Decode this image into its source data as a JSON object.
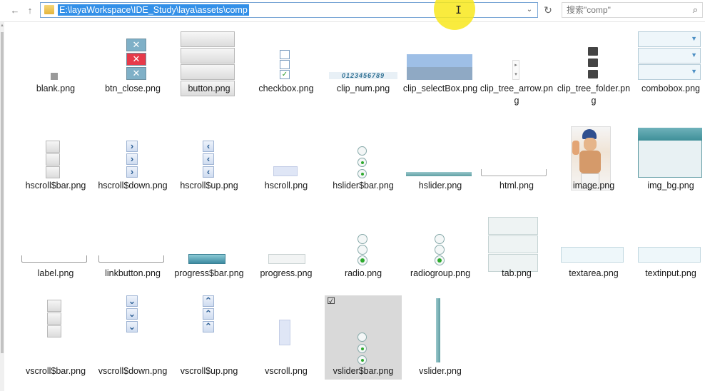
{
  "toolbar": {
    "back_glyph": "←",
    "up_glyph": "↑",
    "address_path": "E:\\layaWorkspace\\IDE_Study\\laya\\assets\\comp",
    "dropdown_glyph": "⌄",
    "refresh_glyph": "↻",
    "search_placeholder": "搜索\"comp\"",
    "search_glyph": "⌕"
  },
  "files": [
    {
      "name": "blank.png",
      "kind": "blank"
    },
    {
      "name": "btn_close.png",
      "kind": "btn_close"
    },
    {
      "name": "button.png",
      "kind": "button"
    },
    {
      "name": "checkbox.png",
      "kind": "checkbox"
    },
    {
      "name": "clip_num.png",
      "kind": "clip_num",
      "text": "0123456789"
    },
    {
      "name": "clip_selectBox.png",
      "kind": "clip_selectBox"
    },
    {
      "name": "clip_tree_arrow.png",
      "kind": "clip_tree_arrow"
    },
    {
      "name": "clip_tree_folder.png",
      "kind": "clip_tree_folder"
    },
    {
      "name": "combobox.png",
      "kind": "combobox"
    },
    {
      "name": "hscroll$bar.png",
      "kind": "scrollbar_bar"
    },
    {
      "name": "hscroll$down.png",
      "kind": "hscroll_down"
    },
    {
      "name": "hscroll$up.png",
      "kind": "hscroll_up"
    },
    {
      "name": "hscroll.png",
      "kind": "hscroll"
    },
    {
      "name": "hslider$bar.png",
      "kind": "slider_bar"
    },
    {
      "name": "hslider.png",
      "kind": "hslider"
    },
    {
      "name": "html.png",
      "kind": "html"
    },
    {
      "name": "image.png",
      "kind": "image"
    },
    {
      "name": "img_bg.png",
      "kind": "img_bg"
    },
    {
      "name": "label.png",
      "kind": "label"
    },
    {
      "name": "linkbutton.png",
      "kind": "linkbutton"
    },
    {
      "name": "progress$bar.png",
      "kind": "progress_bar"
    },
    {
      "name": "progress.png",
      "kind": "progress"
    },
    {
      "name": "radio.png",
      "kind": "radio"
    },
    {
      "name": "radiogroup.png",
      "kind": "radiogroup"
    },
    {
      "name": "tab.png",
      "kind": "tab"
    },
    {
      "name": "textarea.png",
      "kind": "textarea"
    },
    {
      "name": "textinput.png",
      "kind": "textinput"
    },
    {
      "name": "vscroll$bar.png",
      "kind": "vscroll_bar"
    },
    {
      "name": "vscroll$down.png",
      "kind": "vscroll_down"
    },
    {
      "name": "vscroll$up.png",
      "kind": "vscroll_up"
    },
    {
      "name": "vscroll.png",
      "kind": "vscroll"
    },
    {
      "name": "vslider$bar.png",
      "kind": "slider_bar",
      "selected": true
    },
    {
      "name": "vslider.png",
      "kind": "vslider"
    }
  ],
  "colors": {
    "selection_blue": "#3390e8",
    "address_border": "#7aa7d6",
    "item_selected_bg": "#d9d9d9",
    "radio_green": "#2eaa2e"
  }
}
